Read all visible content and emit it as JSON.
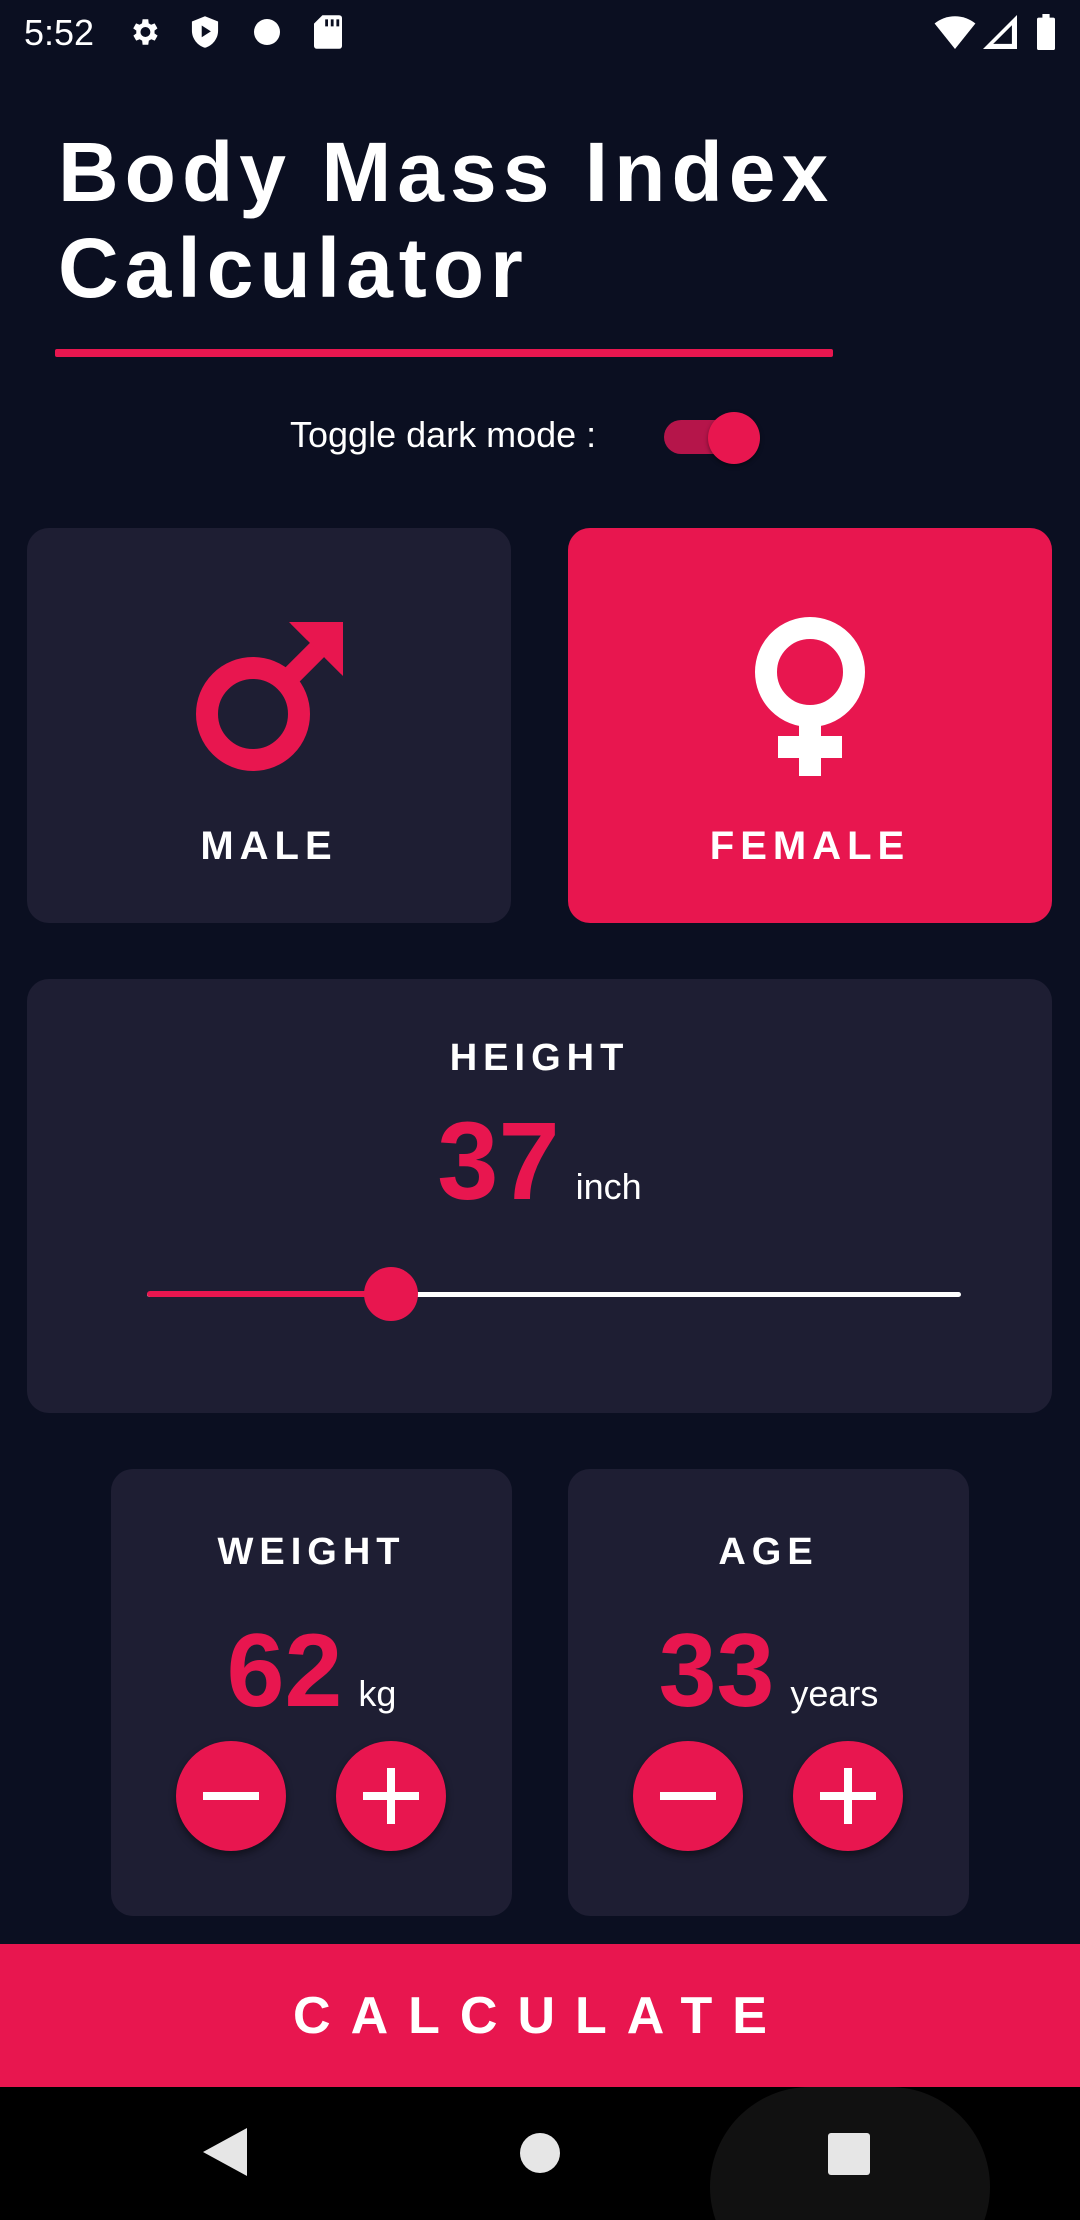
{
  "status_bar": {
    "time": "5:52",
    "icons_left": [
      "gear-icon",
      "shield-play-icon",
      "dot-icon",
      "sd-card-icon"
    ],
    "icons_right": [
      "wifi-icon",
      "cell-signal-icon",
      "battery-icon"
    ]
  },
  "header": {
    "title_line1": "Body Mass Index",
    "title_line2": "Calculator"
  },
  "toggle": {
    "label": "Toggle dark mode :",
    "enabled": true
  },
  "gender": {
    "male_label": "MALE",
    "female_label": "FEMALE",
    "selected": "female"
  },
  "height": {
    "label": "HEIGHT",
    "value": "37",
    "unit": "inch",
    "slider_fraction": 0.3
  },
  "weight": {
    "label": "WEIGHT",
    "value": "62",
    "unit": "kg"
  },
  "age": {
    "label": "AGE",
    "value": "33",
    "unit": "years"
  },
  "calculate": {
    "label": "CALCULATE"
  },
  "nav": [
    "back-icon",
    "home-icon",
    "recents-icon"
  ],
  "colors": {
    "background": "#0b0f21",
    "card": "#1e1e33",
    "accent": "#e8164f"
  }
}
